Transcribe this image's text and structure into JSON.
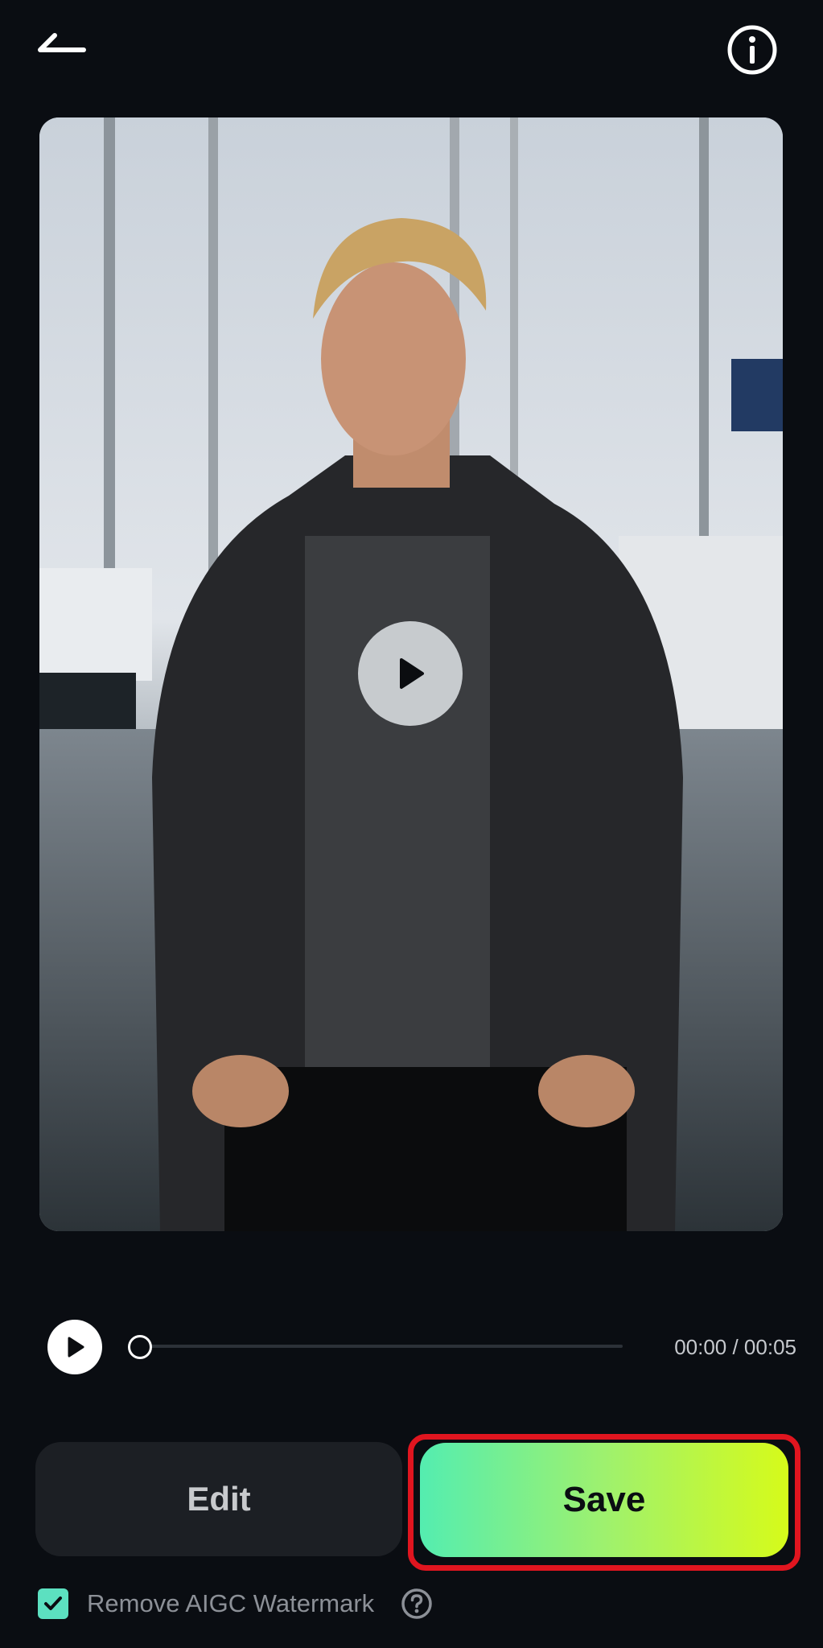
{
  "header": {
    "back_icon": "back-arrow-icon",
    "info_icon": "info-circle-icon"
  },
  "preview": {
    "center_icon": "play-icon"
  },
  "player": {
    "play_icon": "play-icon",
    "current_time": "00:00",
    "duration": "00:05",
    "time_text": "00:00 / 00:05",
    "progress": 0
  },
  "actions": {
    "edit_label": "Edit",
    "save_label": "Save",
    "save_gradient": [
      "#54edb0",
      "#d6fb1a"
    ],
    "highlight_color": "#e0151f"
  },
  "watermark": {
    "checked": true,
    "label": "Remove AIGC Watermark",
    "help_icon": "question-circle-icon",
    "checkbox_color": "#5ce0c0"
  },
  "colors": {
    "background": "#0a0d12",
    "edit_button": "#1c1f24"
  }
}
